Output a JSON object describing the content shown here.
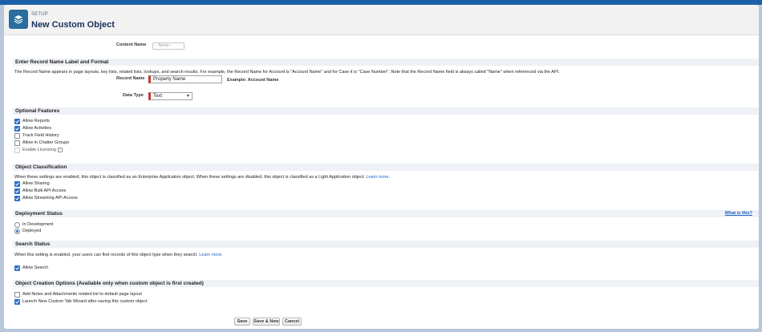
{
  "header": {
    "eyebrow": "SETUP",
    "title": "New Custom Object"
  },
  "content_name": {
    "label": "Content Name",
    "value": "--None--"
  },
  "record_name": {
    "heading": "Enter Record Name Label and Format",
    "description": "The Record Name appears in page layouts, key lists, related lists, lookups, and search results. For example, the Record Name for Account is \"Account Name\" and for Case it is \"Case Number\". Note that the Record Name field is always called \"Name\" when referenced via the API.",
    "field_label": "Record Name",
    "field_value": "Property Name",
    "example": "Example:  Account Name",
    "datatype_label": "Data Type",
    "datatype_value": "Text"
  },
  "optional_features": {
    "heading": "Optional Features",
    "items": [
      {
        "label": "Allow Reports",
        "checked": true
      },
      {
        "label": "Allow Activities",
        "checked": true
      },
      {
        "label": "Track Field History",
        "checked": false
      },
      {
        "label": "Allow in Chatter Groups",
        "checked": false
      },
      {
        "label": "Enable Licensing",
        "checked": false
      }
    ],
    "info_badge": "i"
  },
  "object_classification": {
    "heading": "Object Classification",
    "description": "When these settings are enabled, this object is classified as an Enterprise Application object. When these settings are disabled, this object is classified as a Light Application object.",
    "learn_more": "Learn more.",
    "items": [
      {
        "label": "Allow Sharing",
        "checked": true
      },
      {
        "label": "Allow Bulk API Access",
        "checked": true
      },
      {
        "label": "Allow Streaming API Access",
        "checked": true
      }
    ]
  },
  "deployment_status": {
    "heading": "Deployment Status",
    "what_is_this": "What is this?",
    "options": [
      {
        "label": "In Development",
        "selected": false
      },
      {
        "label": "Deployed",
        "selected": true
      }
    ]
  },
  "search_status": {
    "heading": "Search Status",
    "description": "When this setting is enabled, your users can find records of this object type when they search.",
    "learn_more": "Learn more.",
    "items": [
      {
        "label": "Allow Search",
        "checked": true
      }
    ]
  },
  "creation_options": {
    "heading": "Object Creation Options (Available only when custom object is first created)",
    "items": [
      {
        "label": "Add Notes and Attachments related list to default page layout",
        "checked": false
      },
      {
        "label": "Launch New Custom Tab Wizard after saving this custom object",
        "checked": true
      }
    ]
  },
  "buttons": {
    "save": "Save",
    "save_new": "Save & New",
    "cancel": "Cancel"
  }
}
